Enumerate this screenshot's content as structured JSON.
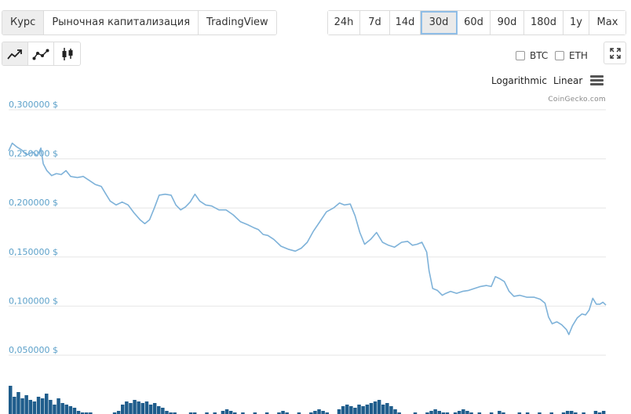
{
  "tabs": [
    "Курс",
    "Рыночная капитализация",
    "TradingView"
  ],
  "active_tab": 0,
  "ranges": [
    "24h",
    "7d",
    "14d",
    "30d",
    "60d",
    "90d",
    "180d",
    "1y",
    "Max"
  ],
  "active_range": 3,
  "chart_modes": [
    {
      "icon": "line-chart-icon"
    },
    {
      "icon": "point-line-chart-icon"
    },
    {
      "icon": "candlestick-icon"
    }
  ],
  "compare": [
    {
      "label": "BTC",
      "checked": false
    },
    {
      "label": "ETH",
      "checked": false
    }
  ],
  "scale_options": [
    "Logarithmic",
    "Linear"
  ],
  "menu_icon": "hamburger-menu-icon",
  "expand_icon": "fullscreen-icon",
  "credit": "CoinGecko.com",
  "colors": {
    "line": "#7eb2d9",
    "volume": "#1f5d8c",
    "grid": "#e6e6e6",
    "axis_text": "#5ba0c9"
  },
  "chart_data": {
    "type": "line",
    "y_ticks": [
      "0,300000 $",
      "0,250000 $",
      "0,200000 $",
      "0,150000 $",
      "0,100000 $",
      "0,050000 $"
    ],
    "y_tick_values": [
      0.3,
      0.25,
      0.2,
      0.15,
      0.1,
      0.05
    ],
    "ylim": [
      0.05,
      0.3
    ],
    "grid": true,
    "x_range": [
      0,
      1
    ],
    "series": [
      {
        "values": [
          [
            0.0,
            0.258
          ],
          [
            0.006,
            0.266
          ],
          [
            0.014,
            0.262
          ],
          [
            0.022,
            0.259
          ],
          [
            0.03,
            0.254
          ],
          [
            0.04,
            0.257
          ],
          [
            0.048,
            0.253
          ],
          [
            0.054,
            0.261
          ],
          [
            0.058,
            0.245
          ],
          [
            0.064,
            0.238
          ],
          [
            0.072,
            0.233
          ],
          [
            0.08,
            0.235
          ],
          [
            0.088,
            0.234
          ],
          [
            0.096,
            0.238
          ],
          [
            0.104,
            0.232
          ],
          [
            0.115,
            0.231
          ],
          [
            0.125,
            0.232
          ],
          [
            0.135,
            0.228
          ],
          [
            0.145,
            0.224
          ],
          [
            0.155,
            0.222
          ],
          [
            0.163,
            0.214
          ],
          [
            0.17,
            0.207
          ],
          [
            0.18,
            0.203
          ],
          [
            0.19,
            0.206
          ],
          [
            0.2,
            0.203
          ],
          [
            0.21,
            0.195
          ],
          [
            0.22,
            0.188
          ],
          [
            0.228,
            0.184
          ],
          [
            0.236,
            0.188
          ],
          [
            0.244,
            0.2
          ],
          [
            0.252,
            0.213
          ],
          [
            0.262,
            0.214
          ],
          [
            0.272,
            0.213
          ],
          [
            0.28,
            0.203
          ],
          [
            0.288,
            0.198
          ],
          [
            0.296,
            0.201
          ],
          [
            0.304,
            0.206
          ],
          [
            0.312,
            0.214
          ],
          [
            0.32,
            0.207
          ],
          [
            0.33,
            0.203
          ],
          [
            0.34,
            0.202
          ],
          [
            0.352,
            0.198
          ],
          [
            0.364,
            0.198
          ],
          [
            0.376,
            0.193
          ],
          [
            0.388,
            0.186
          ],
          [
            0.4,
            0.183
          ],
          [
            0.41,
            0.18
          ],
          [
            0.418,
            0.178
          ],
          [
            0.426,
            0.173
          ],
          [
            0.434,
            0.172
          ],
          [
            0.444,
            0.168
          ],
          [
            0.456,
            0.161
          ],
          [
            0.468,
            0.158
          ],
          [
            0.48,
            0.156
          ],
          [
            0.49,
            0.159
          ],
          [
            0.5,
            0.165
          ],
          [
            0.51,
            0.176
          ],
          [
            0.52,
            0.185
          ],
          [
            0.532,
            0.196
          ],
          [
            0.544,
            0.2
          ],
          [
            0.554,
            0.205
          ],
          [
            0.562,
            0.203
          ],
          [
            0.572,
            0.204
          ],
          [
            0.58,
            0.192
          ],
          [
            0.588,
            0.175
          ],
          [
            0.596,
            0.163
          ],
          [
            0.606,
            0.168
          ],
          [
            0.616,
            0.175
          ],
          [
            0.626,
            0.165
          ],
          [
            0.636,
            0.162
          ],
          [
            0.646,
            0.16
          ],
          [
            0.658,
            0.165
          ],
          [
            0.668,
            0.166
          ],
          [
            0.676,
            0.162
          ],
          [
            0.684,
            0.163
          ],
          [
            0.692,
            0.165
          ],
          [
            0.7,
            0.155
          ],
          [
            0.704,
            0.136
          ],
          [
            0.71,
            0.118
          ],
          [
            0.718,
            0.116
          ],
          [
            0.726,
            0.111
          ],
          [
            0.732,
            0.113
          ],
          [
            0.74,
            0.115
          ],
          [
            0.75,
            0.113
          ],
          [
            0.76,
            0.115
          ],
          [
            0.77,
            0.116
          ],
          [
            0.78,
            0.118
          ],
          [
            0.79,
            0.12
          ],
          [
            0.8,
            0.121
          ],
          [
            0.808,
            0.12
          ],
          [
            0.815,
            0.13
          ],
          [
            0.822,
            0.128
          ],
          [
            0.83,
            0.125
          ],
          [
            0.838,
            0.115
          ],
          [
            0.846,
            0.11
          ],
          [
            0.856,
            0.111
          ],
          [
            0.868,
            0.109
          ],
          [
            0.88,
            0.109
          ],
          [
            0.89,
            0.107
          ],
          [
            0.898,
            0.103
          ],
          [
            0.904,
            0.089
          ],
          [
            0.91,
            0.082
          ],
          [
            0.918,
            0.084
          ],
          [
            0.926,
            0.081
          ],
          [
            0.934,
            0.076
          ],
          [
            0.938,
            0.071
          ],
          [
            0.944,
            0.08
          ],
          [
            0.952,
            0.088
          ],
          [
            0.96,
            0.092
          ],
          [
            0.966,
            0.091
          ],
          [
            0.972,
            0.096
          ],
          [
            0.978,
            0.108
          ],
          [
            0.984,
            0.102
          ],
          [
            0.99,
            0.102
          ],
          [
            0.995,
            0.104
          ],
          [
            1.0,
            0.101
          ]
        ]
      }
    ],
    "volume": [
      0.9,
      0.55,
      0.7,
      0.5,
      0.6,
      0.45,
      0.4,
      0.55,
      0.5,
      0.65,
      0.45,
      0.3,
      0.5,
      0.35,
      0.3,
      0.25,
      0.2,
      0.1,
      0.05,
      0.05,
      0.05,
      0.0,
      0.0,
      0.0,
      0.0,
      0.0,
      0.05,
      0.1,
      0.3,
      0.4,
      0.35,
      0.45,
      0.4,
      0.35,
      0.4,
      0.3,
      0.35,
      0.25,
      0.2,
      0.1,
      0.05,
      0.05,
      0.0,
      0.0,
      0.0,
      0.05,
      0.05,
      0.0,
      0.0,
      0.05,
      0.0,
      0.05,
      0.0,
      0.1,
      0.15,
      0.1,
      0.05,
      0.0,
      0.05,
      0.0,
      0.0,
      0.05,
      0.0,
      0.0,
      0.05,
      0.0,
      0.0,
      0.05,
      0.1,
      0.05,
      0.0,
      0.0,
      0.05,
      0.0,
      0.0,
      0.05,
      0.1,
      0.15,
      0.1,
      0.05,
      0.0,
      0.0,
      0.15,
      0.25,
      0.3,
      0.25,
      0.2,
      0.3,
      0.25,
      0.3,
      0.35,
      0.4,
      0.45,
      0.3,
      0.35,
      0.25,
      0.15,
      0.05,
      0.0,
      0.0,
      0.0,
      0.05,
      0.0,
      0.0,
      0.05,
      0.1,
      0.15,
      0.1,
      0.05,
      0.05,
      0.0,
      0.05,
      0.1,
      0.15,
      0.1,
      0.05,
      0.0,
      0.05,
      0.0,
      0.0,
      0.05,
      0.0,
      0.1,
      0.05,
      0.0,
      0.0,
      0.0,
      0.05,
      0.0,
      0.05,
      0.0,
      0.0,
      0.05,
      0.0,
      0.0,
      0.05,
      0.0,
      0.0,
      0.05,
      0.1,
      0.1,
      0.05,
      0.0,
      0.05,
      0.0,
      0.0,
      0.1,
      0.05,
      0.1
    ]
  }
}
